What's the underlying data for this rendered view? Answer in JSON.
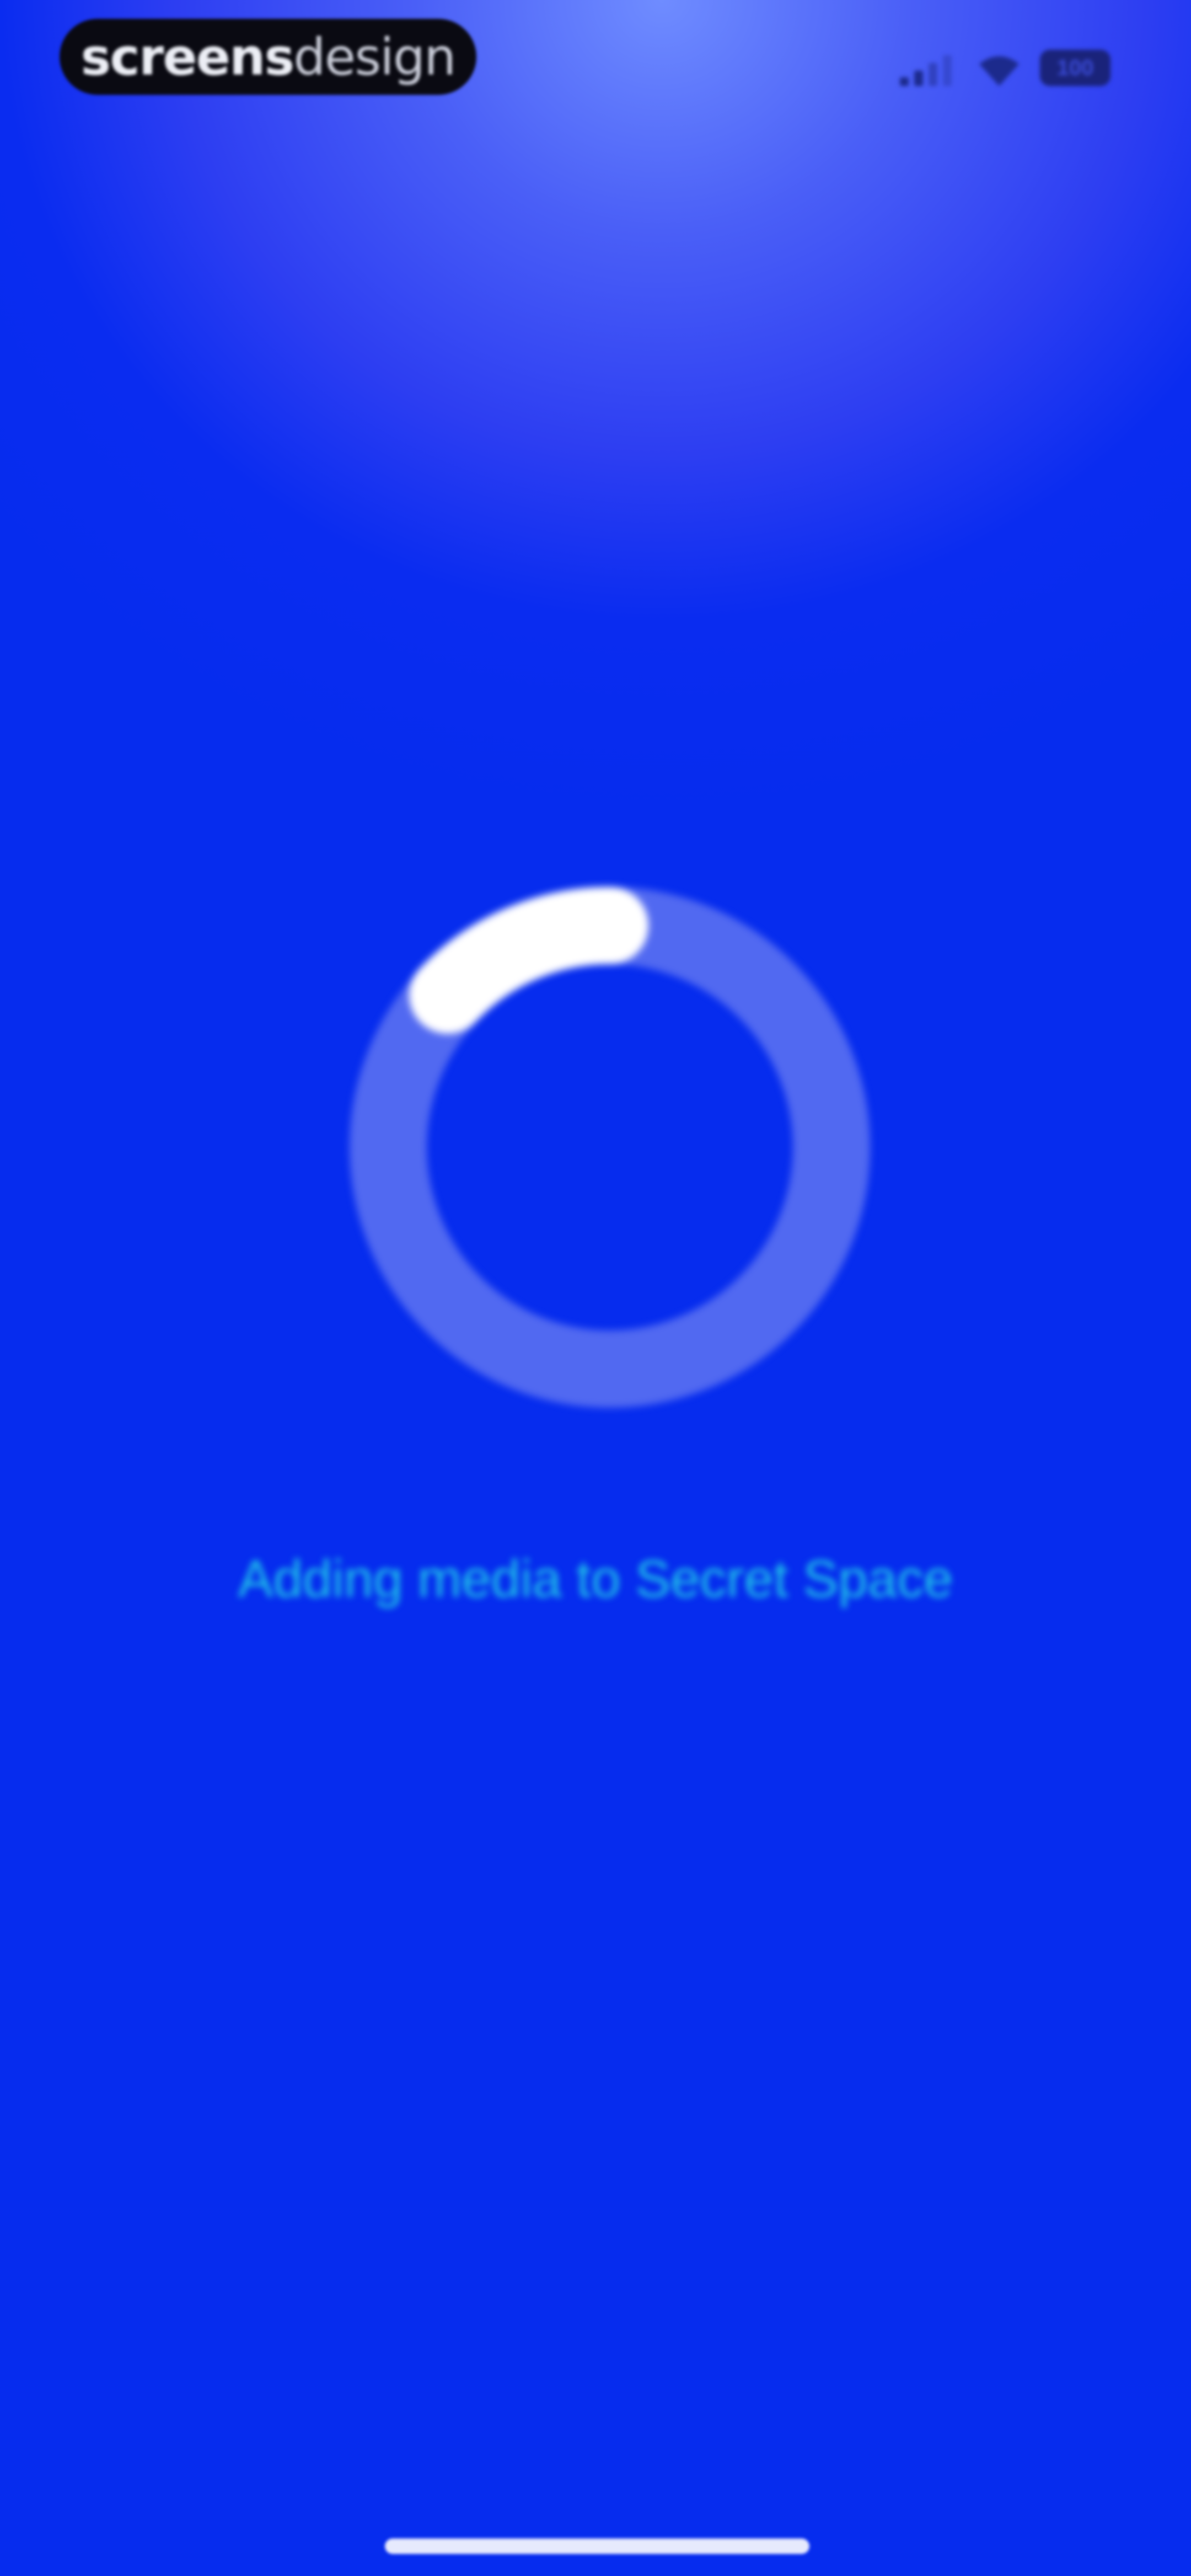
{
  "status_bar": {
    "brand_logo": {
      "bold_part": "screens",
      "light_part": "design"
    },
    "battery_label": "100",
    "signal_icon": "cellular-signal-icon",
    "wifi_icon": "wifi-icon"
  },
  "loader": {
    "icon": "loading-spinner-icon",
    "message": "Adding media to Secret Space"
  },
  "colors": {
    "background_top": "#6f8cff",
    "background_bottom": "#062cee",
    "accent_text": "#20c7e8",
    "spinner_track": "#6b7df2",
    "spinner_arc": "#ffffff"
  }
}
